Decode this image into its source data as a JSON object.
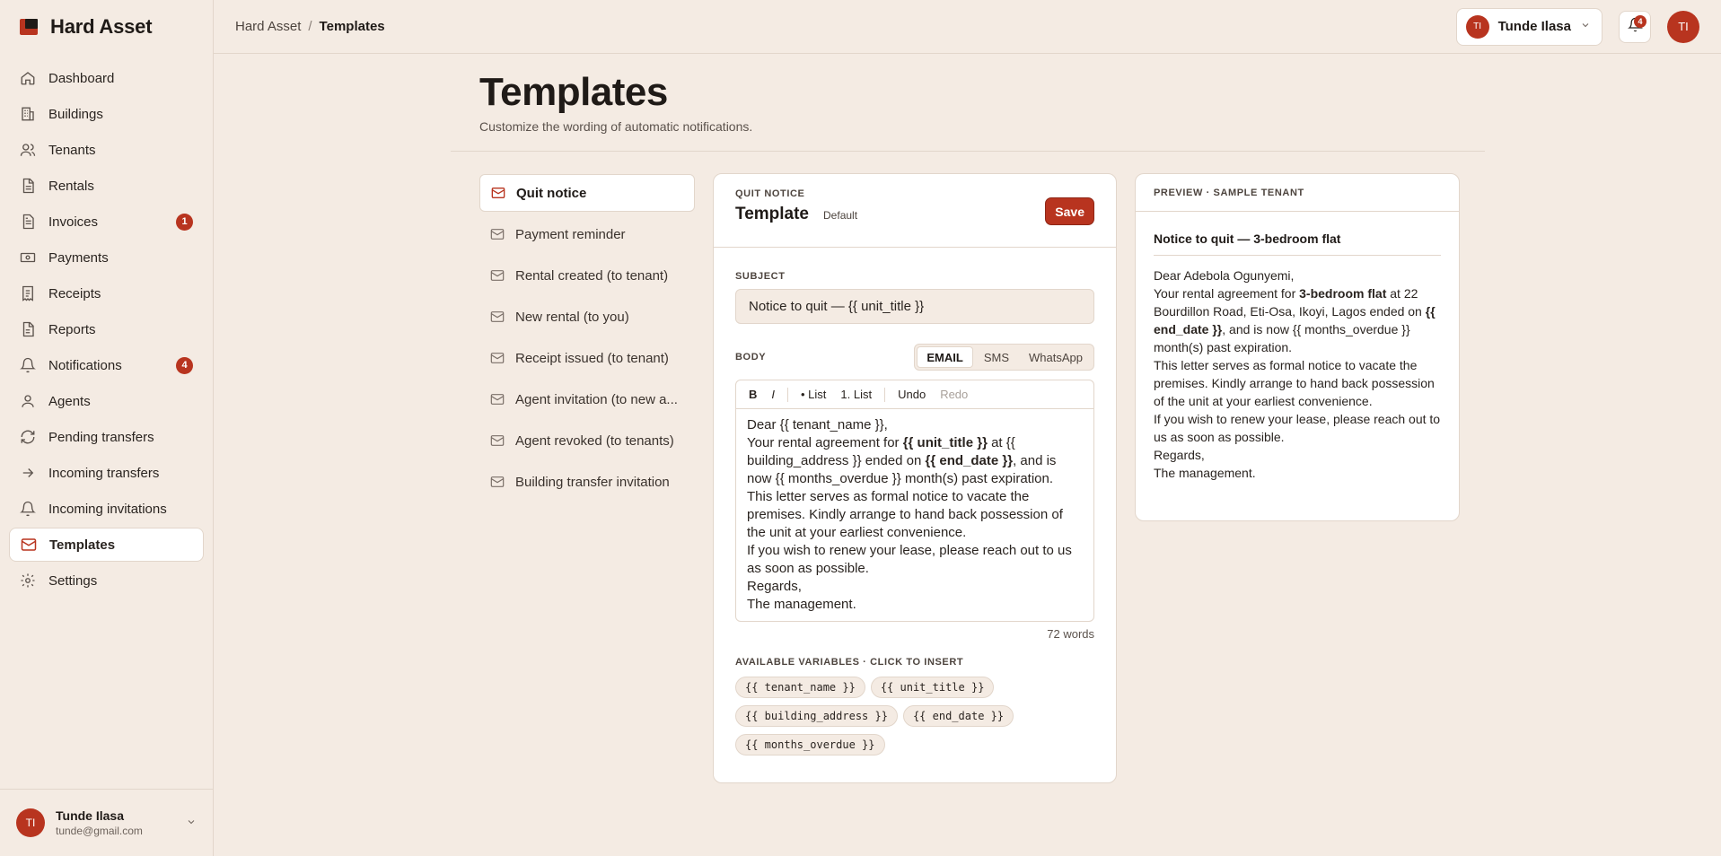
{
  "brand": {
    "name": "Hard Asset"
  },
  "sidebar": {
    "items": [
      {
        "label": "Dashboard"
      },
      {
        "label": "Buildings"
      },
      {
        "label": "Tenants"
      },
      {
        "label": "Rentals"
      },
      {
        "label": "Invoices",
        "badge": "1"
      },
      {
        "label": "Payments"
      },
      {
        "label": "Receipts"
      },
      {
        "label": "Reports"
      },
      {
        "label": "Notifications",
        "badge": "4"
      },
      {
        "label": "Agents"
      },
      {
        "label": "Pending transfers"
      },
      {
        "label": "Incoming transfers"
      },
      {
        "label": "Incoming invitations"
      },
      {
        "label": "Templates"
      },
      {
        "label": "Settings"
      }
    ],
    "user": {
      "initials": "TI",
      "name": "Tunde Ilasa",
      "email": "tunde@gmail.com"
    }
  },
  "topbar": {
    "breadcrumb": {
      "root": "Hard Asset",
      "separator": "/",
      "current": "Templates"
    },
    "account": {
      "initials": "TI",
      "name": "Tunde Ilasa"
    },
    "notifications_count": "4",
    "avatar_initials": "TI"
  },
  "page": {
    "title": "Templates",
    "subtitle": "Customize the wording of automatic notifications."
  },
  "templates": [
    {
      "label": "Quit notice"
    },
    {
      "label": "Payment reminder"
    },
    {
      "label": "Rental created (to tenant)"
    },
    {
      "label": "New rental (to you)"
    },
    {
      "label": "Receipt issued (to tenant)"
    },
    {
      "label": "Agent invitation (to new a..."
    },
    {
      "label": "Agent revoked (to tenants)"
    },
    {
      "label": "Building transfer invitation"
    }
  ],
  "editor": {
    "eyebrow": "QUIT NOTICE",
    "title": "Template",
    "default_label": "Default",
    "save_label": "Save",
    "subject_label": "SUBJECT",
    "subject_value": "Notice to quit — {{ unit_title }}",
    "body_label": "BODY",
    "channels": [
      "EMAIL",
      "SMS",
      "WhatsApp"
    ],
    "toolbar": {
      "bold": "B",
      "italic": "I",
      "bullet": "• List",
      "numbered": "1. List",
      "undo": "Undo",
      "redo": "Redo"
    },
    "body": {
      "l1": "Dear {{ tenant_name }},",
      "l2a": "Your rental agreement for ",
      "l2b": "{{ unit_title }}",
      "l2c": " at {{ building_address }} ended on ",
      "l2d": "{{ end_date }}",
      "l2e": ", and is now {{ months_overdue }} month(s) past expiration.",
      "l3": "This letter serves as formal notice to vacate the premises. Kindly arrange to hand back possession of the unit at your earliest convenience.",
      "l4": "If you wish to renew your lease, please reach out to us as soon as possible.",
      "l5": "Regards,",
      "l6": "The management."
    },
    "word_count": "72 words",
    "vars_label": "AVAILABLE VARIABLES · CLICK TO INSERT",
    "variables": [
      "{{ tenant_name }}",
      "{{ unit_title }}",
      "{{ building_address }}",
      "{{ end_date }}",
      "{{ months_overdue }}"
    ]
  },
  "preview": {
    "eyebrow": "PREVIEW · SAMPLE TENANT",
    "subject": "Notice to quit — 3-bedroom flat",
    "body": {
      "l1": "Dear Adebola Ogunyemi,",
      "l2a": "Your rental agreement for ",
      "l2b": "3-bedroom flat",
      "l2c": " at 22 Bourdillon Road, Eti-Osa, Ikoyi, Lagos ended on ",
      "l2d": "{{ end_date }}",
      "l2e": ", and is now {{ months_overdue }} month(s) past expiration.",
      "l3": "This letter serves as formal notice to vacate the premises. Kindly arrange to hand back possession of the unit at your earliest convenience.",
      "l4": "If you wish to renew your lease, please reach out to us as soon as possible.",
      "l5": "Regards,",
      "l6": "The management."
    }
  },
  "colors": {
    "accent": "#b8341f",
    "background": "#f4ebe3",
    "border": "#e2d6cb"
  }
}
